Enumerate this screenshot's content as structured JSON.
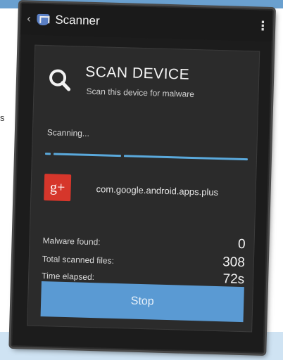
{
  "side_text": "s",
  "appbar": {
    "back_icon": "chevron-left-icon",
    "logo_icon": "shield-logo-icon",
    "title": "Scanner",
    "menu_icon": "more-vert-icon"
  },
  "scan": {
    "title": "SCAN DEVICE",
    "subtitle": "Scan this device for malware",
    "status": "Scanning...",
    "progress": 1.0,
    "current_file": "com.google.android.apps.plus",
    "current_file_icon": "google-plus-icon",
    "current_file_icon_text": "g+"
  },
  "stats": [
    {
      "label": "Malware found:",
      "value": "0"
    },
    {
      "label": "Total scanned files:",
      "value": "308"
    },
    {
      "label": "Time elapsed:",
      "value": "72s"
    }
  ],
  "stop_label": "Stop",
  "colors": {
    "accent": "#5a9ad3",
    "progress": "#5aa9dc",
    "gplus": "#d6362b",
    "card": "#2b2b2b",
    "band": "#6aa0cf"
  }
}
